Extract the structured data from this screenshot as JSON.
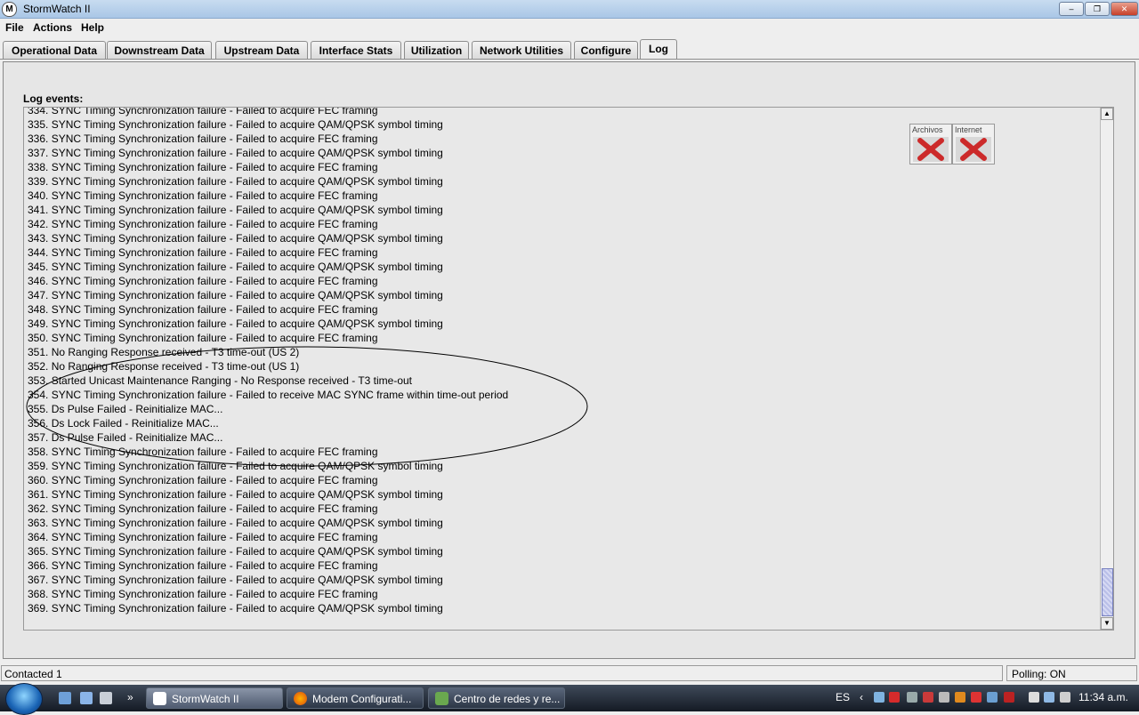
{
  "window": {
    "title": "StormWatch II",
    "controls": {
      "minimize": "–",
      "maximize": "❐",
      "close": "✕"
    }
  },
  "menu": [
    "File",
    "Actions",
    "Help"
  ],
  "tabs": [
    "Operational Data",
    "Downstream Data",
    "Upstream Data",
    "Interface Stats",
    "Utilization",
    "Network Utilities",
    "Configure",
    "Log"
  ],
  "active_tab": "Log",
  "log": {
    "label": "Log events:",
    "lines": [
      "334. SYNC Timing Synchronization failure - Failed to acquire FEC framing",
      "335. SYNC Timing Synchronization failure - Failed to acquire QAM/QPSK symbol timing",
      "336. SYNC Timing Synchronization failure - Failed to acquire FEC framing",
      "337. SYNC Timing Synchronization failure - Failed to acquire QAM/QPSK symbol timing",
      "338. SYNC Timing Synchronization failure - Failed to acquire FEC framing",
      "339. SYNC Timing Synchronization failure - Failed to acquire QAM/QPSK symbol timing",
      "340. SYNC Timing Synchronization failure - Failed to acquire FEC framing",
      "341. SYNC Timing Synchronization failure - Failed to acquire QAM/QPSK symbol timing",
      "342. SYNC Timing Synchronization failure - Failed to acquire FEC framing",
      "343. SYNC Timing Synchronization failure - Failed to acquire QAM/QPSK symbol timing",
      "344. SYNC Timing Synchronization failure - Failed to acquire FEC framing",
      "345. SYNC Timing Synchronization failure - Failed to acquire QAM/QPSK symbol timing",
      "346. SYNC Timing Synchronization failure - Failed to acquire FEC framing",
      "347. SYNC Timing Synchronization failure - Failed to acquire QAM/QPSK symbol timing",
      "348. SYNC Timing Synchronization failure - Failed to acquire FEC framing",
      "349. SYNC Timing Synchronization failure - Failed to acquire QAM/QPSK symbol timing",
      "350. SYNC Timing Synchronization failure - Failed to acquire FEC framing",
      "351. No Ranging Response received - T3 time-out (US 2)",
      "352. No Ranging Response received - T3 time-out (US 1)",
      "353. Started Unicast Maintenance Ranging - No Response received - T3 time-out",
      "354. SYNC Timing Synchronization failure - Failed to receive MAC SYNC frame within time-out period",
      "355. Ds Pulse Failed - Reinitialize MAC...",
      "356. Ds Lock Failed - Reinitialize MAC...",
      "357. Ds Pulse Failed - Reinitialize MAC...",
      "358. SYNC Timing Synchronization failure - Failed to acquire FEC framing",
      "359. SYNC Timing Synchronization failure - Failed to acquire QAM/QPSK symbol timing",
      "360. SYNC Timing Synchronization failure - Failed to acquire FEC framing",
      "361. SYNC Timing Synchronization failure - Failed to acquire QAM/QPSK symbol timing",
      "362. SYNC Timing Synchronization failure - Failed to acquire FEC framing",
      "363. SYNC Timing Synchronization failure - Failed to acquire QAM/QPSK symbol timing",
      "364. SYNC Timing Synchronization failure - Failed to acquire FEC framing",
      "365. SYNC Timing Synchronization failure - Failed to acquire QAM/QPSK symbol timing",
      "366. SYNC Timing Synchronization failure - Failed to acquire FEC framing",
      "367. SYNC Timing Synchronization failure - Failed to acquire QAM/QPSK symbol timing",
      "368. SYNC Timing Synchronization failure - Failed to acquire FEC framing",
      "369. SYNC Timing Synchronization failure - Failed to acquire QAM/QPSK symbol timing"
    ]
  },
  "badges": [
    {
      "label": "Archivos",
      "icon": "red-x-icon"
    },
    {
      "label": "Internet",
      "icon": "red-x-icon"
    }
  ],
  "status": {
    "left": "Contacted 1",
    "right": "Polling: ON"
  },
  "taskbar": {
    "items": [
      "StormWatch II",
      "Modem Configurati...",
      "Centro de redes y re..."
    ],
    "language": "ES",
    "clock": "11:34 a.m."
  },
  "colors": {
    "accent_red": "#cc2a2a",
    "scroll_thumb": "#b9bfe8"
  }
}
